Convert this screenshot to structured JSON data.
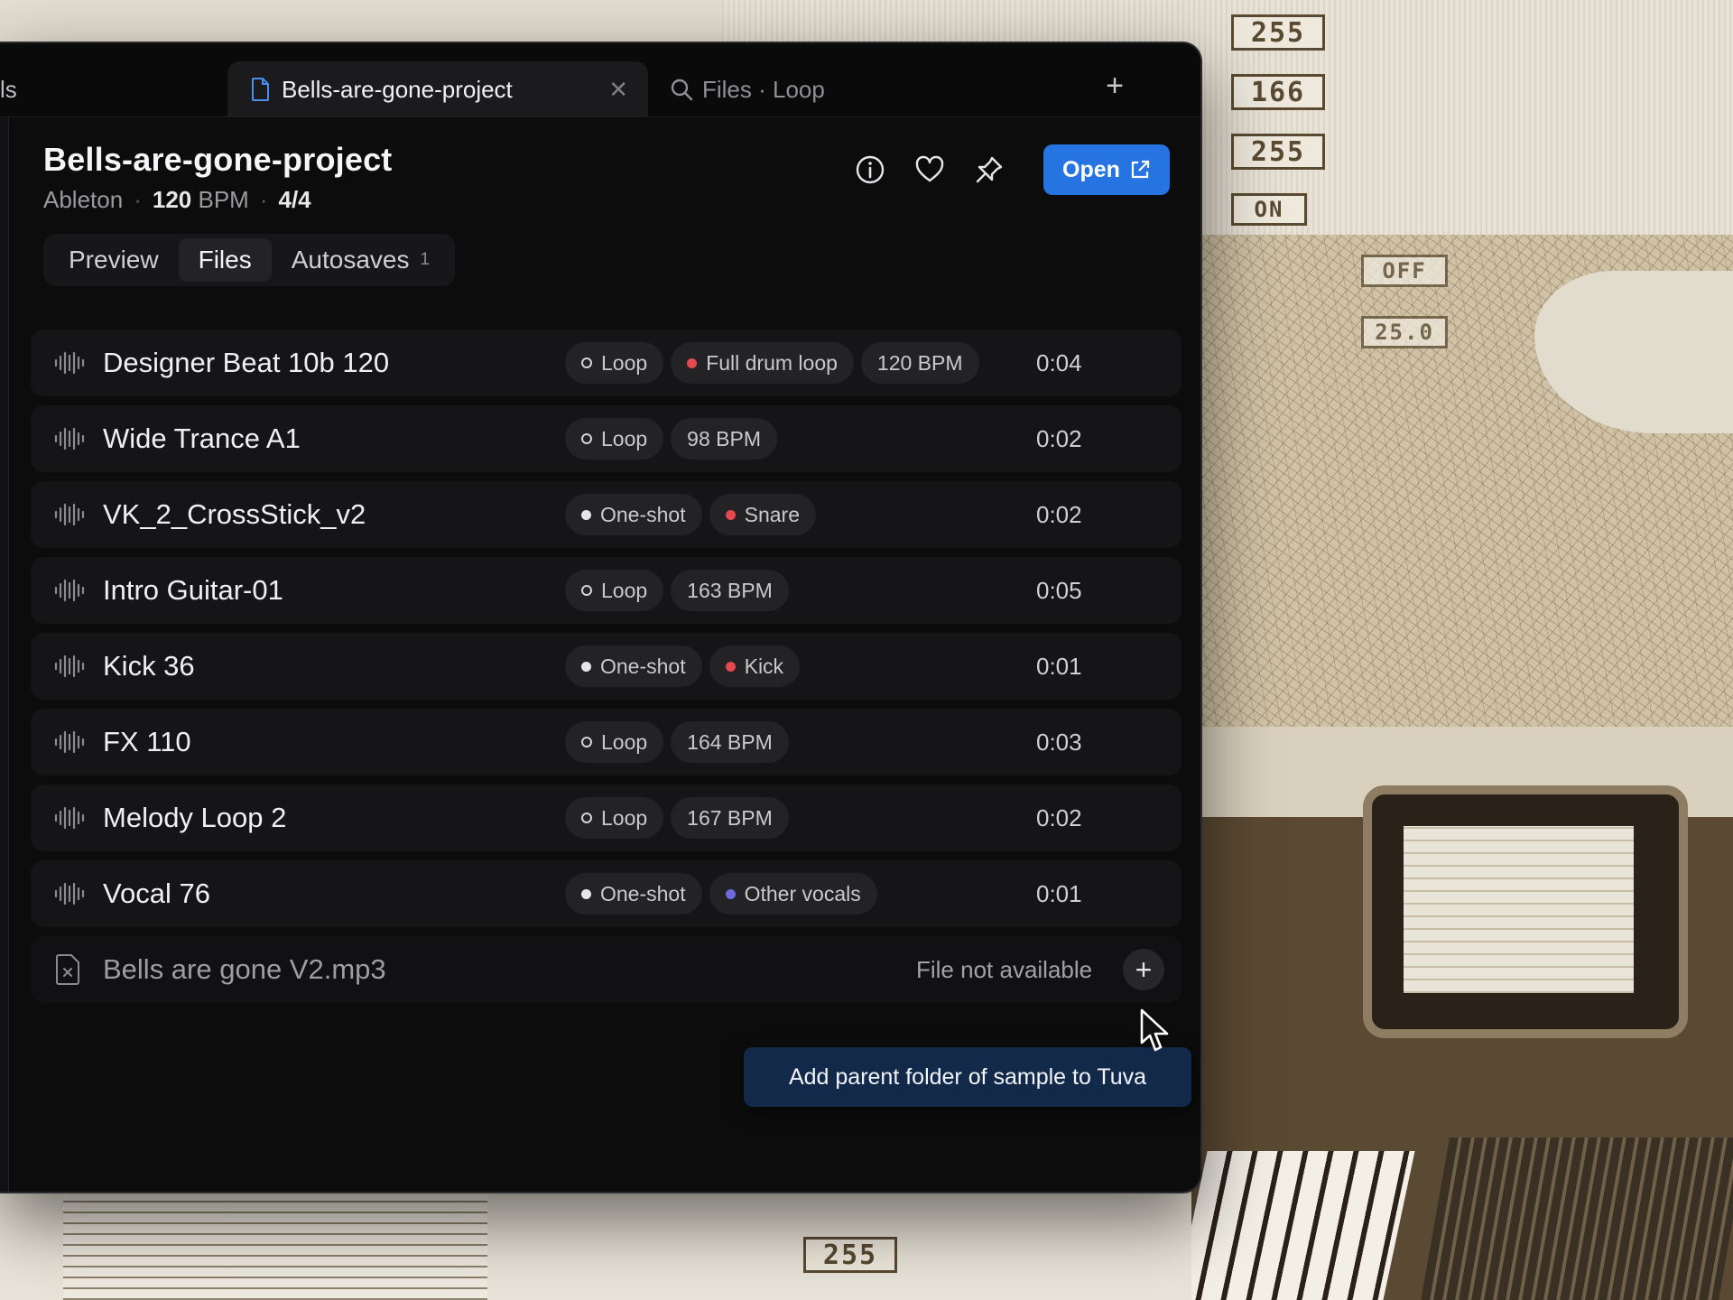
{
  "background": {
    "readouts": [
      "255",
      "166",
      "255",
      "ON",
      "OFF",
      "25.0",
      "255"
    ]
  },
  "tabs": {
    "partial_label": "ls",
    "active_label": "Bells-are-gone-project",
    "search_label": "Files · Loop"
  },
  "project": {
    "title": "Bells-are-gone-project",
    "daw": "Ableton",
    "bpm_value": "120",
    "bpm_unit": "BPM",
    "time_signature": "4/4",
    "open_label": "Open"
  },
  "views": [
    {
      "label": "Preview"
    },
    {
      "label": "Files"
    },
    {
      "label": "Autosaves",
      "count": "1"
    }
  ],
  "files": [
    {
      "name": "Designer Beat 10b 120",
      "tags": [
        {
          "label": "Loop"
        },
        {
          "label": "Full drum loop"
        },
        {
          "label": "120 BPM"
        }
      ],
      "duration": "0:04"
    },
    {
      "name": "Wide Trance A1",
      "tags": [
        {
          "label": "Loop"
        },
        {
          "label": "98 BPM"
        }
      ],
      "duration": "0:02"
    },
    {
      "name": "VK_2_CrossStick_v2",
      "tags": [
        {
          "label": "One-shot"
        },
        {
          "label": "Snare"
        }
      ],
      "duration": "0:02"
    },
    {
      "name": "Intro Guitar-01",
      "tags": [
        {
          "label": "Loop"
        },
        {
          "label": "163 BPM"
        }
      ],
      "duration": "0:05"
    },
    {
      "name": "Kick 36",
      "tags": [
        {
          "label": "One-shot"
        },
        {
          "label": "Kick"
        }
      ],
      "duration": "0:01"
    },
    {
      "name": "FX 110",
      "tags": [
        {
          "label": "Loop"
        },
        {
          "label": "164 BPM"
        }
      ],
      "duration": "0:03"
    },
    {
      "name": "Melody Loop 2",
      "tags": [
        {
          "label": "Loop"
        },
        {
          "label": "167 BPM"
        }
      ],
      "duration": "0:02"
    },
    {
      "name": "Vocal 76",
      "tags": [
        {
          "label": "One-shot"
        },
        {
          "label": "Other vocals"
        }
      ],
      "duration": "0:01"
    }
  ],
  "missing_file": {
    "name": "Bells are gone V2.mp3",
    "status": "File not available",
    "add_label": "+"
  },
  "tooltip": "Add parent folder of sample to Tuva",
  "colors": {
    "accent": "#2674e2",
    "category_red": "#e5484d",
    "category_purple": "#6e6ade",
    "tooltip_bg": "#13294a"
  }
}
